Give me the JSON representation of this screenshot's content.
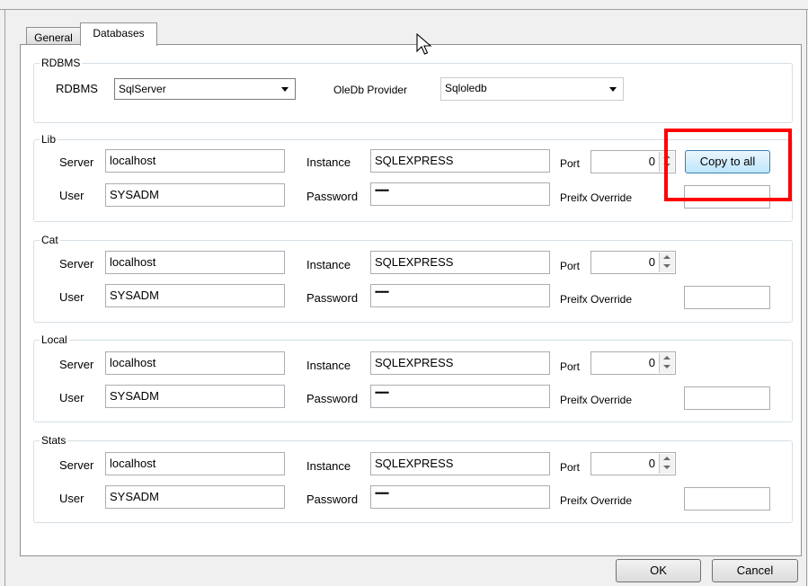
{
  "tabs": [
    "General",
    "Databases"
  ],
  "active_tab": "Databases",
  "rdbms_group": {
    "legend": "RDBMS",
    "rdbms_label": "RDBMS",
    "rdbms_value": "SqlServer",
    "provider_label": "OleDb Provider",
    "provider_value": "Sqloledb"
  },
  "labels": {
    "server": "Server",
    "user": "User",
    "instance": "Instance",
    "password": "Password",
    "port": "Port",
    "prefix_override": "Preifx Override"
  },
  "groups": [
    {
      "name": "Lib",
      "server": "localhost",
      "user": "SYSADM",
      "instance": "SQLEXPRESS",
      "password": "•••••••",
      "port": "0",
      "prefix": ""
    },
    {
      "name": "Cat",
      "server": "localhost",
      "user": "SYSADM",
      "instance": "SQLEXPRESS",
      "password": "•••••••",
      "port": "0",
      "prefix": ""
    },
    {
      "name": "Local",
      "server": "localhost",
      "user": "SYSADM",
      "instance": "SQLEXPRESS",
      "password": "•••••••",
      "port": "0",
      "prefix": ""
    },
    {
      "name": "Stats",
      "server": "localhost",
      "user": "SYSADM",
      "instance": "SQLEXPRESS",
      "password": "•••••••",
      "port": "0",
      "prefix": ""
    }
  ],
  "copy_to_all_label": "Copy to all",
  "ok_label": "OK",
  "cancel_label": "Cancel",
  "colors": {
    "highlight": "#ff0000",
    "window_bg": "#f0f0f0",
    "panel_bg": "#ffffff"
  }
}
